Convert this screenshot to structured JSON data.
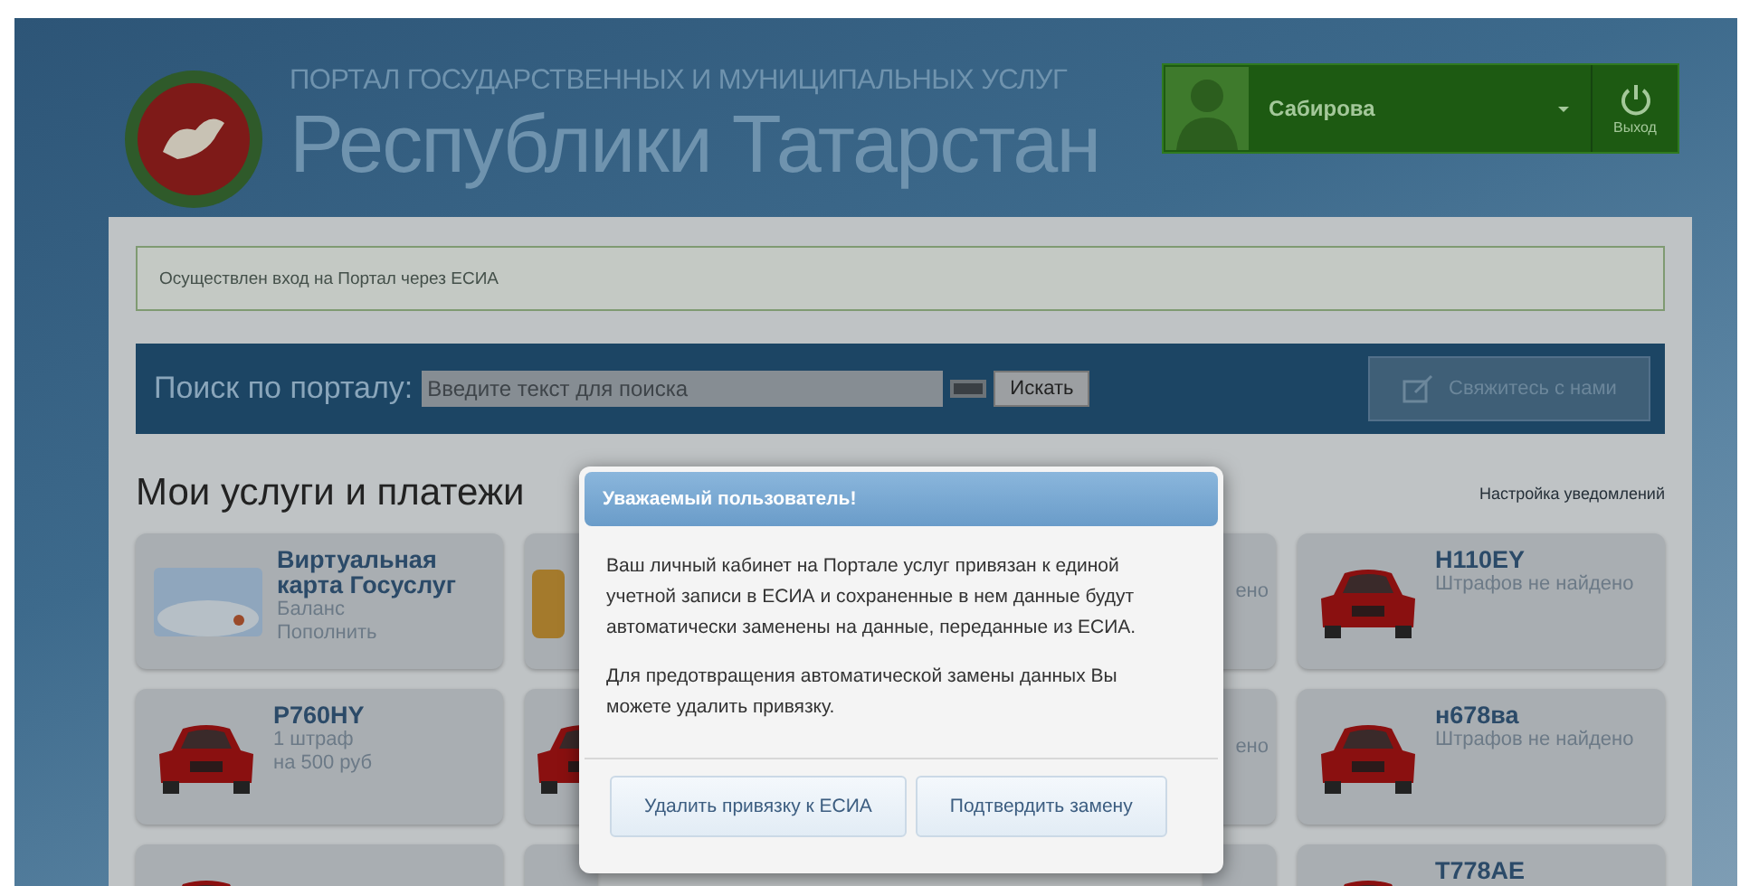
{
  "header": {
    "subtitle": "ПОРТАЛ ГОСУДАРСТВЕННЫХ И МУНИЦИПАЛЬНЫХ УСЛУГ",
    "title": "Республики Татарстан",
    "user": "Сабирова",
    "logout": "Выход"
  },
  "notice": "Осуществлен вход на Портал через ЕСИА",
  "search": {
    "label": "Поиск по порталу:",
    "placeholder": "Введите текст для поиска",
    "button": "Искать",
    "contact": "Свяжитесь с нами"
  },
  "section": {
    "title": "Мои услуги и платежи",
    "settings_link": "Настройка уведомлений"
  },
  "cards": [
    {
      "kind": "bankcard",
      "title": "Виртуальная карта Госуслуг",
      "lines": [
        "Баланс",
        "Пополнить"
      ]
    },
    {
      "kind": "coins"
    },
    {
      "kind": "none",
      "lines": [
        "ено"
      ]
    },
    {
      "kind": "car",
      "title": "H110EY",
      "lines": [
        "Штрафов не найдено"
      ]
    },
    {
      "kind": "car",
      "title": "P760HY",
      "lines": [
        "1 штраф",
        "на 500 руб"
      ]
    },
    {
      "kind": "car"
    },
    {
      "kind": "none",
      "lines": [
        "ено"
      ]
    },
    {
      "kind": "car",
      "title": "н678ва",
      "lines": [
        "Штрафов не найдено"
      ]
    },
    {
      "kind": "car"
    },
    {
      "kind": "none"
    },
    {
      "kind": "none"
    },
    {
      "kind": "car",
      "title": "T778AE"
    }
  ],
  "modal": {
    "title": "Уважаемый пользователь!",
    "paragraphs": [
      "Ваш личный кабинет на Портале услуг привязан к единой учетной записи в ЕСИА и сохраненные в нем данные будут автоматически заменены на данные, переданные из ЕСИА.",
      "Для предотвращения автоматической замены данных Вы можете удалить привязку."
    ],
    "buttons": [
      "Удалить привязку к ЕСИА",
      "Подтвердить замену"
    ]
  }
}
